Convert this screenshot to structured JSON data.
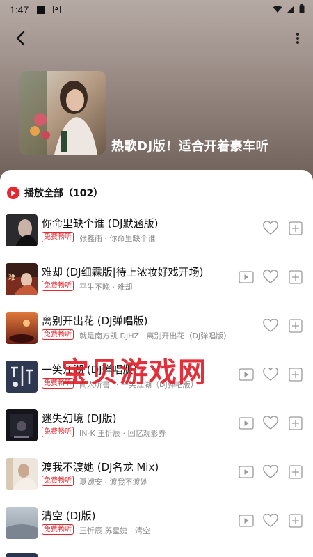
{
  "status_bar": {
    "time": "1:47",
    "notification_letter": "A"
  },
  "playlist": {
    "title": "热歌DJ版！适合开着豪车听"
  },
  "play_all": {
    "label": "播放全部（102）"
  },
  "songs": [
    {
      "title": "你命里缺个谁 (DJ默涵版)",
      "badge": "免费畅听",
      "artist": "张鑫雨 · 你命里缺个谁",
      "has_video": false
    },
    {
      "title": "难却 (DJ细霖版|待上浓妆好戏开场)",
      "badge": "免费畅听",
      "artist": "平生不晚 · 难却",
      "has_video": true
    },
    {
      "title": "离别开出花 (DJ弹唱版)",
      "badge": "免费畅听",
      "artist": "就是南方凯 DJHZ · 离别开出花（DJ弹唱版）",
      "has_video": false
    },
    {
      "title": "一笑江湖 (DJ弹唱版)",
      "badge": "免费畅听",
      "artist": "闻人听書_ · 一笑江湖（DJ弹唱版）",
      "has_video": true
    },
    {
      "title": "迷失幻境 (DJ版)",
      "badge": "免费畅听",
      "artist": "IN-K 王忻辰 · 回忆观影券",
      "has_video": true
    },
    {
      "title": "渡我不渡她 (DJ名龙 Mix)",
      "badge": "免费畅听",
      "artist": "夏婉安 · 渡我不渡她",
      "has_video": true
    },
    {
      "title": "清空 (DJ版)",
      "badge": "免费畅听",
      "artist": "王忻辰 苏星婕 · 清空",
      "has_video": true
    }
  ],
  "watermark": "宝贝游戏网",
  "colors": {
    "accent": "#e8262e",
    "text": "#111111",
    "muted": "#8c8c8c"
  }
}
